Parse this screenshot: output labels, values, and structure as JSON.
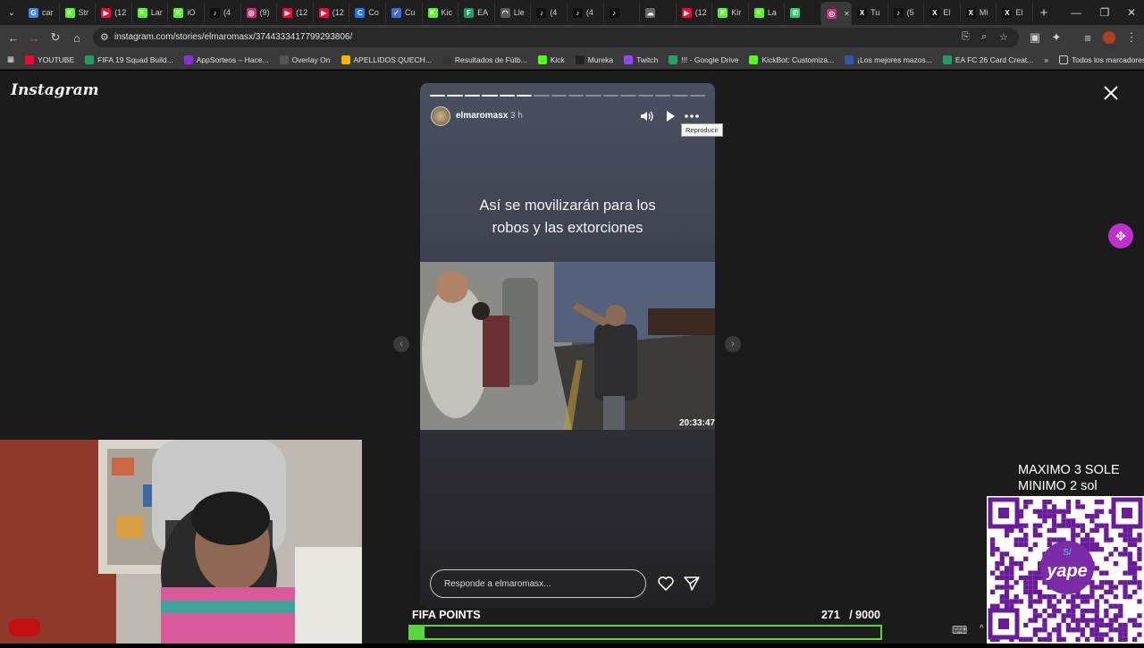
{
  "browser": {
    "tabs": [
      {
        "label": "car",
        "color": "#4285f4",
        "glyph": "G"
      },
      {
        "label": "Str",
        "color": "#53fc18",
        "glyph": "K"
      },
      {
        "label": "(12",
        "color": "#ff0033",
        "glyph": "▶"
      },
      {
        "label": "Lar",
        "color": "#53fc18",
        "glyph": "K"
      },
      {
        "label": "iO",
        "color": "#53fc18",
        "glyph": "K"
      },
      {
        "label": "(4",
        "color": "#111111",
        "glyph": "♪"
      },
      {
        "label": "(9)",
        "color": "#d62976",
        "glyph": "◎"
      },
      {
        "label": "(12",
        "color": "#ff0033",
        "glyph": "▶"
      },
      {
        "label": "(12",
        "color": "#ff0033",
        "glyph": "▶"
      },
      {
        "label": "Co",
        "color": "#1877f2",
        "glyph": "C"
      },
      {
        "label": "Cu",
        "color": "#3b6bd6",
        "glyph": "✓"
      },
      {
        "label": "Kic",
        "color": "#53fc18",
        "glyph": "K"
      },
      {
        "label": "EA",
        "color": "#1f9e63",
        "glyph": "F"
      },
      {
        "label": "Lle",
        "color": "#5a5a5a",
        "glyph": "◠"
      },
      {
        "label": "(4",
        "color": "#111111",
        "glyph": "♪"
      },
      {
        "label": "(4",
        "color": "#111111",
        "glyph": "♪"
      },
      {
        "label": "",
        "color": "#111111",
        "glyph": "♪"
      },
      {
        "label": "",
        "color": "#666666",
        "glyph": "☁"
      },
      {
        "label": "(12",
        "color": "#ff0033",
        "glyph": "▶"
      },
      {
        "label": "Kir",
        "color": "#53fc18",
        "glyph": "K"
      },
      {
        "label": "La",
        "color": "#53fc18",
        "glyph": "K"
      },
      {
        "label": "",
        "color": "#25d366",
        "glyph": "✆"
      },
      {
        "label": "",
        "color": "#d62976",
        "glyph": "◎"
      },
      {
        "label": "Tu",
        "color": "#111111",
        "glyph": "X"
      },
      {
        "label": "(5",
        "color": "#111111",
        "glyph": "♪"
      },
      {
        "label": "El",
        "color": "#111111",
        "glyph": "X"
      },
      {
        "label": "Mi",
        "color": "#111111",
        "glyph": "X"
      },
      {
        "label": "El",
        "color": "#111111",
        "glyph": "X"
      }
    ],
    "new_tab": "+",
    "url": "instagram.com/stories/elmaromasx/3744333417799293806/",
    "bookmarks": [
      {
        "label": "YOUTUBE",
        "color": "#ff0033"
      },
      {
        "label": "FIFA 19 Squad Build...",
        "color": "#1f9e63"
      },
      {
        "label": "AppSorteos – Hace...",
        "color": "#8a2be2"
      },
      {
        "label": "Overlay On",
        "color": "#555555"
      },
      {
        "label": "APELLIDOS QUECH...",
        "color": "#f4b400"
      },
      {
        "label": "Resultados de Fútb...",
        "color": "#333333"
      },
      {
        "label": "Kick",
        "color": "#53fc18"
      },
      {
        "label": "Mureka",
        "color": "#222222"
      },
      {
        "label": "Twitch",
        "color": "#9146ff"
      },
      {
        "label": "!!! - Google Drive",
        "color": "#1fa463"
      },
      {
        "label": "KickBot: Customiza...",
        "color": "#53fc18"
      },
      {
        "label": "¡Los mejores mazos...",
        "color": "#3355aa"
      },
      {
        "label": "EA FC 26 Card Creat...",
        "color": "#1f9e63"
      }
    ],
    "all_bookmarks": "Todos los marcadores"
  },
  "instagram": {
    "logo": "Instagram",
    "story": {
      "username": "elmaromasx",
      "time_ago": "3 h",
      "segments_total": 16,
      "segments_done": 6,
      "headline_line1": "Así se movilizarán para los",
      "headline_line2": "robos y las extorciones",
      "video_timestamp": "20:33:47",
      "tooltip": "Reproducir",
      "reply_placeholder": "Responde a elmaromasx..."
    }
  },
  "overlay": {
    "fifa_label": "FIFA POINTS",
    "fifa_current": "271",
    "fifa_total": "/ 9000",
    "fifa_fraction": 0.0301,
    "donation_line1": "MAXIMO 3 SOLE",
    "donation_line2": "MINIMO 2 sol",
    "qr_brand": "yape",
    "qr_badge": "S/"
  },
  "colors": {
    "accent_green": "#5bd63a",
    "ext_button": "#c02fd0",
    "qr_purple": "#6a1b9a"
  }
}
